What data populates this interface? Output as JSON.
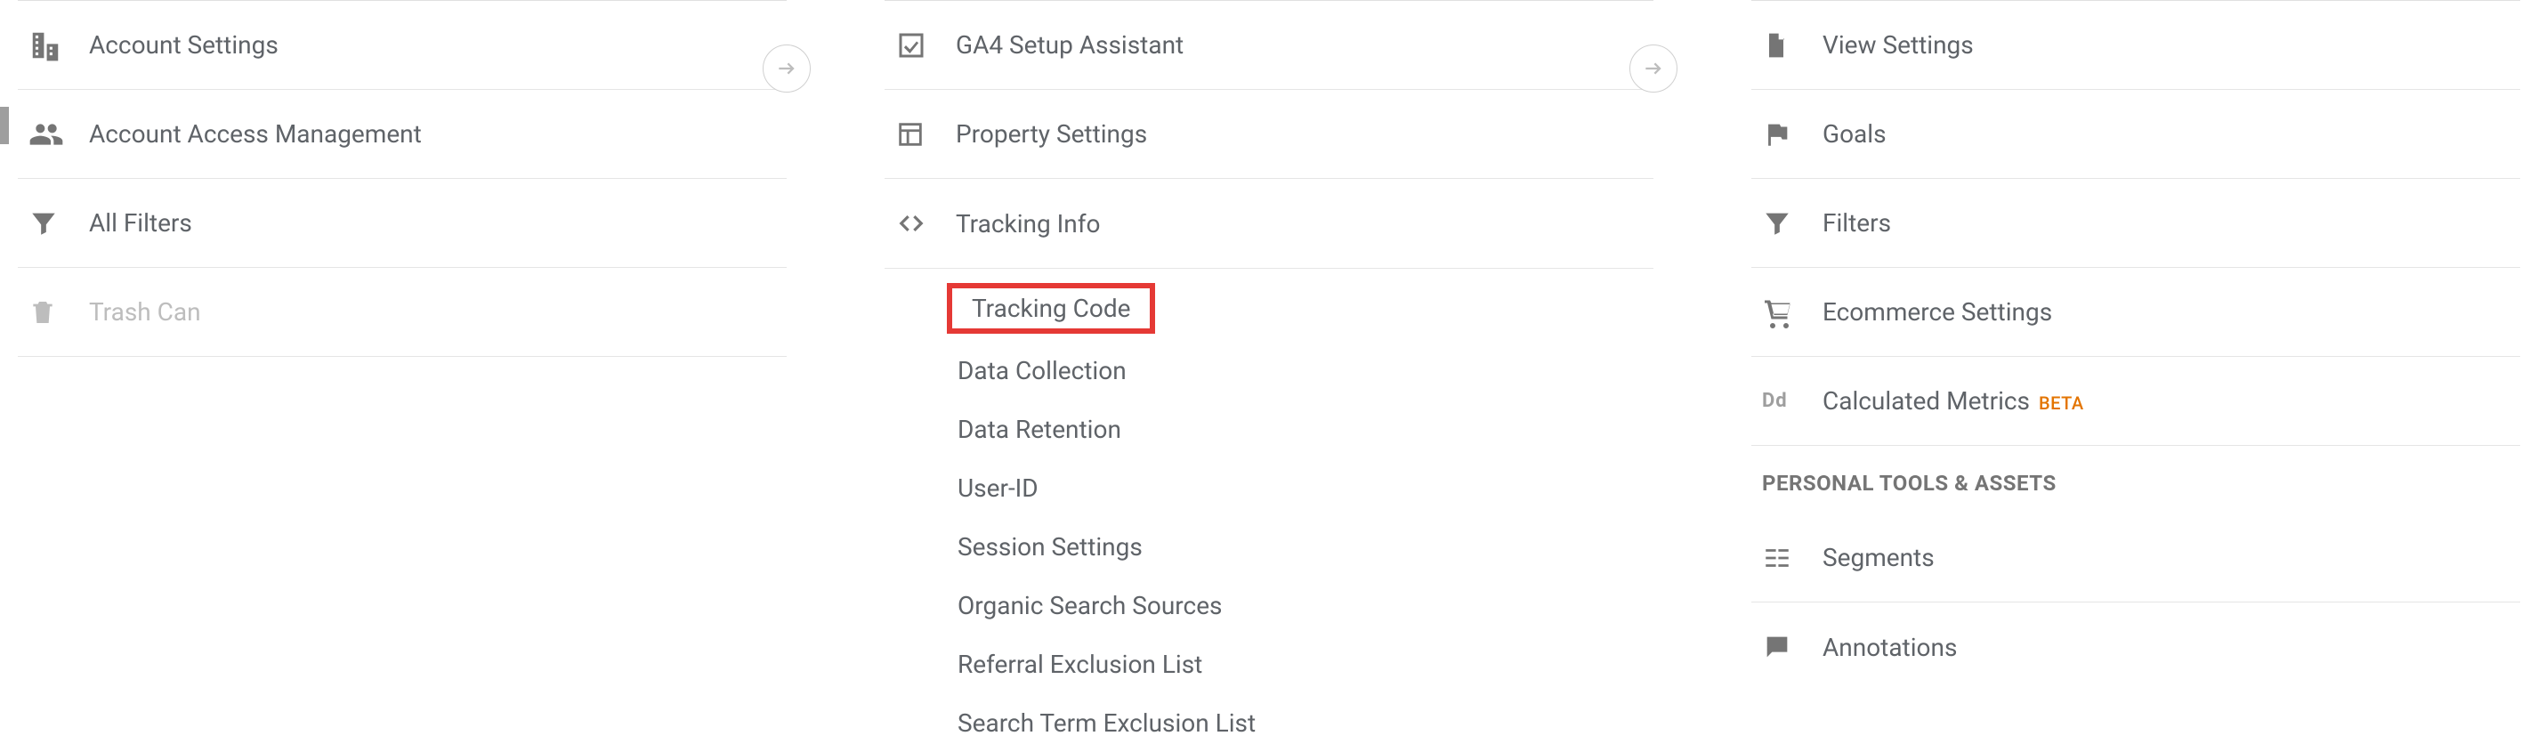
{
  "account": {
    "items": [
      {
        "label": "Account Settings"
      },
      {
        "label": "Account Access Management"
      },
      {
        "label": "All Filters"
      },
      {
        "label": "Trash Can"
      }
    ]
  },
  "property": {
    "items": [
      {
        "label": "GA4 Setup Assistant"
      },
      {
        "label": "Property Settings"
      },
      {
        "label": "Tracking Info"
      }
    ],
    "tracking_sub": [
      "Tracking Code",
      "Data Collection",
      "Data Retention",
      "User-ID",
      "Session Settings",
      "Organic Search Sources",
      "Referral Exclusion List",
      "Search Term Exclusion List"
    ]
  },
  "view": {
    "items": [
      {
        "label": "View Settings"
      },
      {
        "label": "Goals"
      },
      {
        "label": "Filters"
      },
      {
        "label": "Ecommerce Settings"
      },
      {
        "label": "Calculated Metrics",
        "badge": "BETA"
      }
    ],
    "section_label": "PERSONAL TOOLS & ASSETS",
    "tools": [
      {
        "label": "Segments"
      },
      {
        "label": "Annotations"
      }
    ]
  }
}
